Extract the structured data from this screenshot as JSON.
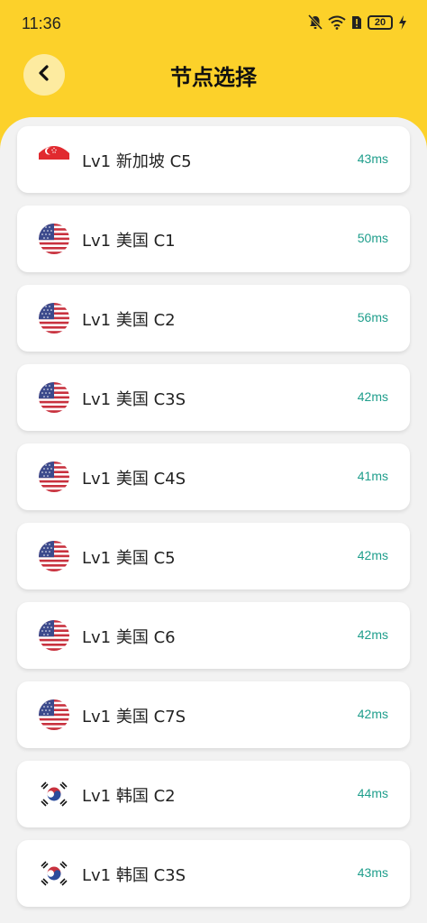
{
  "status_bar": {
    "time": "11:36",
    "battery": "20",
    "icons": [
      "bell-muted-icon",
      "wifi-icon",
      "sim-alert-icon",
      "battery-icon",
      "charging-icon"
    ]
  },
  "header": {
    "title": "节点选择",
    "back_icon": "chevron-left-icon"
  },
  "colors": {
    "accent": "#FCD12A",
    "latency": "#1F9E8C",
    "background": "#F2F2F2"
  },
  "nodes": [
    {
      "name": "Lv1 新加坡 C5",
      "latency": "43ms",
      "flag": "sg"
    },
    {
      "name": "Lv1 美国 C1",
      "latency": "50ms",
      "flag": "us"
    },
    {
      "name": "Lv1 美国 C2",
      "latency": "56ms",
      "flag": "us"
    },
    {
      "name": "Lv1 美国 C3S",
      "latency": "42ms",
      "flag": "us"
    },
    {
      "name": "Lv1 美国 C4S",
      "latency": "41ms",
      "flag": "us"
    },
    {
      "name": "Lv1 美国 C5",
      "latency": "42ms",
      "flag": "us"
    },
    {
      "name": "Lv1 美国 C6",
      "latency": "42ms",
      "flag": "us"
    },
    {
      "name": "Lv1 美国 C7S",
      "latency": "42ms",
      "flag": "us"
    },
    {
      "name": "Lv1 韩国 C2",
      "latency": "44ms",
      "flag": "kr"
    },
    {
      "name": "Lv1 韩国 C3S",
      "latency": "43ms",
      "flag": "kr"
    }
  ]
}
